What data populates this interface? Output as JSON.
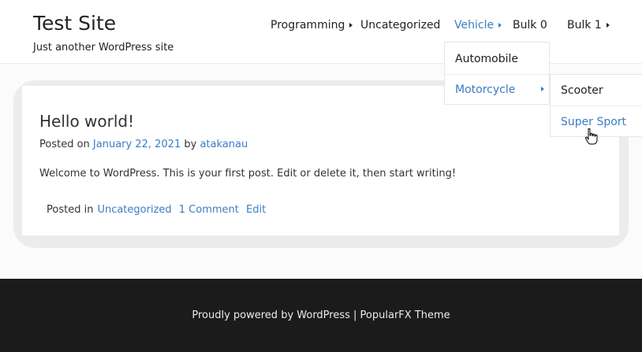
{
  "header": {
    "site_title": "Test Site",
    "tagline": "Just another WordPress site"
  },
  "nav": {
    "items": [
      {
        "label": "Programming",
        "has_submenu": true
      },
      {
        "label": "Uncategorized",
        "has_submenu": false
      },
      {
        "label": "Vehicle",
        "has_submenu": true,
        "active": true
      },
      {
        "label": "Bulk 0",
        "has_submenu": false
      },
      {
        "label": "Bulk 1",
        "has_submenu": true
      }
    ],
    "vehicle_submenu": [
      {
        "label": "Automobile"
      },
      {
        "label": "Motorcycle",
        "has_submenu": true,
        "active": true
      }
    ],
    "motorcycle_submenu": [
      {
        "label": "Scooter"
      },
      {
        "label": "Super Sport",
        "hovered": true
      }
    ]
  },
  "post": {
    "title": "Hello world!",
    "posted_on_label": "Posted on",
    "date": "January 22, 2021",
    "by_label": "by",
    "author": "atakanau",
    "body": "Welcome to WordPress. This is your first post. Edit or delete it, then start writing!",
    "posted_in_label": "Posted in",
    "category": "Uncategorized",
    "comments": "1 Comment",
    "edit": "Edit"
  },
  "footer": {
    "text": "Proudly powered by WordPress | PopularFX Theme"
  },
  "colors": {
    "link": "#3a7dc5",
    "footer_bg": "#1b1b1b",
    "page_bg": "#fbfbfb"
  }
}
